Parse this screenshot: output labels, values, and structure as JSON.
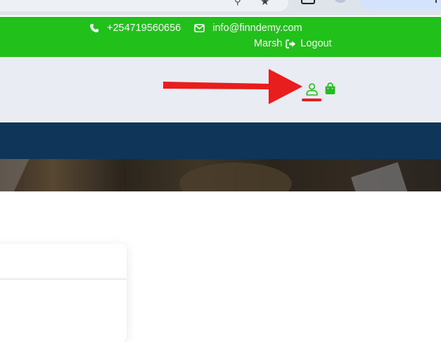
{
  "topbar": {
    "phone": "+254719560656",
    "email": "info@finndemy.com",
    "username": "Marsh",
    "logout_label": "Logout"
  },
  "icons": {
    "phone": "phone-icon",
    "email": "envelope-icon",
    "logout": "sign-out-icon",
    "account": "user-icon",
    "cart": "shopping-bag-icon",
    "annotation": "red-arrow"
  },
  "colors": {
    "topbar_bg": "#21c01a",
    "header_bg": "#e9ecf3",
    "navbar_bg": "#0f3558",
    "accent_green": "#21c01a",
    "annotation_red": "#e81d1d"
  }
}
